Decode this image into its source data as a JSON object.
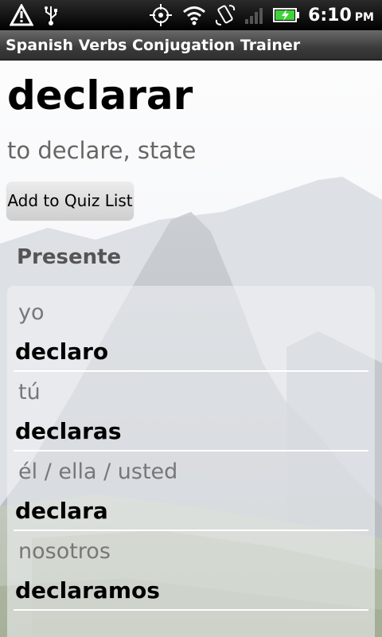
{
  "status_bar": {
    "icons": [
      "alert-triangle-icon",
      "usb-icon",
      "gps-icon",
      "wifi-icon",
      "rotate-icon",
      "signal-icon",
      "battery-icon"
    ],
    "time": "6:10",
    "ampm": "PM"
  },
  "app": {
    "title": "Spanish Verbs Conjugation Trainer"
  },
  "verb": {
    "infinitive": "declarar",
    "meaning": "to declare, state"
  },
  "actions": {
    "add_to_quiz_label": "Add to Quiz List"
  },
  "tense": {
    "name": "Presente",
    "rows": [
      {
        "pronoun": "yo",
        "form": "declaro"
      },
      {
        "pronoun": "tú",
        "form": "declaras"
      },
      {
        "pronoun": "él / ella / usted",
        "form": "declara"
      },
      {
        "pronoun": "nosotros",
        "form": "declaramos"
      }
    ]
  },
  "colors": {
    "battery_green": "#3fd43a",
    "meaning_gray": "#666666",
    "pronoun_gray": "#777777"
  }
}
